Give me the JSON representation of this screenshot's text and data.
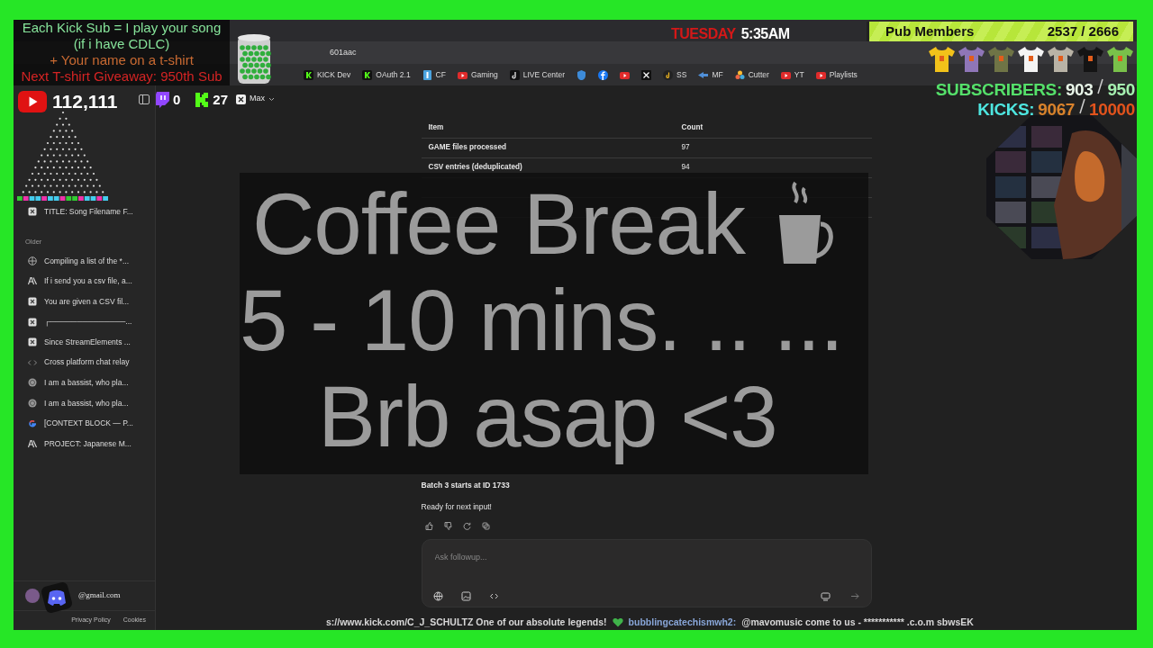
{
  "stream_overlay": {
    "promo_lines": [
      {
        "text": "Each Kick Sub = I play your song",
        "kind": "main"
      },
      {
        "text": "(if i have CDLC)",
        "kind": "main"
      },
      {
        "text": "+ Your name on a t-shirt",
        "kind": "bonus"
      },
      {
        "text": "Next T-shirt Giveaway: 950th Sub",
        "kind": "alert"
      }
    ],
    "youtube_count": "112,111",
    "twitch_count": "0",
    "kick_count": "27",
    "clock": {
      "day": "TUESDAY",
      "time": "5:35AM"
    },
    "pub_members": {
      "label": "Pub Members",
      "count": "2537 / 2666"
    },
    "shirts": [
      {
        "color": "#f2c21a"
      },
      {
        "color": "#8f76b8"
      },
      {
        "color": "#6f7446"
      },
      {
        "color": "#f4f4f4"
      },
      {
        "color": "#b9b3a6"
      },
      {
        "color": "#141414"
      },
      {
        "color": "#79c14a"
      }
    ],
    "goals": [
      {
        "label": "SUBSCRIBERS:",
        "current": "903",
        "target": "950",
        "kind": "subs"
      },
      {
        "label": "KICKS:",
        "current": "9067",
        "target": "10000",
        "kind": "kicks"
      }
    ],
    "break_screen": {
      "lines": [
        "Coffee Break",
        "5 - 10 mins. .. ...",
        "Brb asap <3"
      ]
    },
    "ticker": [
      {
        "text": "s://www.kick.com/C_J_SCHULTZ One of our absolute legends!",
        "kind": "message"
      },
      {
        "kind": "heart"
      },
      {
        "text": "bubblingcatechismwh2:",
        "kind": "user"
      },
      {
        "text": "@mavomusic come to us - *********** .c.o.m sbwsEK",
        "kind": "message"
      }
    ]
  },
  "browser": {
    "address_end": "601aac",
    "bookmarks": [
      {
        "label": "KICK Dev",
        "kind": "kick"
      },
      {
        "label": "OAuth 2.1",
        "kind": "kick"
      },
      {
        "label": "CF",
        "kind": "bar"
      },
      {
        "label": "Gaming",
        "kind": "youtube"
      },
      {
        "label": "LIVE Center",
        "kind": "tiktok"
      },
      {
        "kind": "shield"
      },
      {
        "kind": "facebook"
      },
      {
        "kind": "youtube"
      },
      {
        "kind": "x"
      },
      {
        "label": "SS",
        "kind": "music"
      },
      {
        "label": "MF",
        "kind": "arrow"
      },
      {
        "label": "Cutter",
        "kind": "dots"
      },
      {
        "label": "YT",
        "kind": "youtube"
      },
      {
        "label": "Playlists",
        "kind": "youtube"
      }
    ]
  },
  "model_selector": "Max",
  "sidebar": {
    "pinned": [
      {
        "title": "TITLE: Song Filename F...",
        "kind": "grid"
      }
    ],
    "section": "Older",
    "items": [
      {
        "title": "Compiling a list of the *...",
        "kind": "globe"
      },
      {
        "title": "If i send you a csv file, a...",
        "kind": "letters"
      },
      {
        "title": "You are given a CSV fil...",
        "kind": "grid"
      },
      {
        "title": "┌──────────────...",
        "kind": "grid"
      },
      {
        "title": "Since StreamElements ...",
        "kind": "grid"
      },
      {
        "title": "Cross platform chat relay",
        "kind": "code"
      },
      {
        "title": "I am a bassist, who pla...",
        "kind": "spiral"
      },
      {
        "title": "I am a bassist, who pla...",
        "kind": "spiral"
      },
      {
        "title": "[CONTEXT BLOCK — P...",
        "kind": "google"
      },
      {
        "title": "PROJECT: Japanese M...",
        "kind": "letters"
      }
    ],
    "account": "@gmail.com",
    "footer": [
      "Privacy Policy",
      "Cookies"
    ]
  },
  "summary_table": {
    "columns": [
      "Item",
      "Count"
    ],
    "rows": [
      [
        "GAME files processed",
        "97"
      ],
      [
        "CSV entries (deduplicated)",
        "94"
      ]
    ]
  },
  "next_batch": {
    "text": "Batch 3 starts at ID 1733",
    "status": "Ready for next input!"
  },
  "composer": {
    "placeholder": "Ask followup..."
  }
}
